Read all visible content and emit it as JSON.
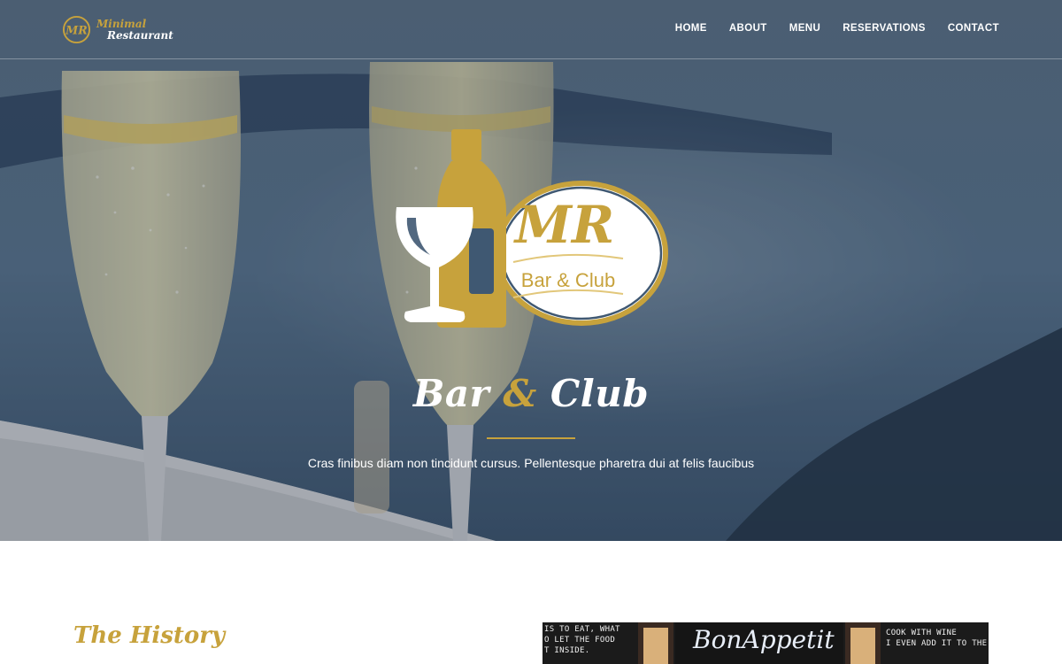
{
  "colors": {
    "gold": "#c7a23c",
    "navy": "#3f5872",
    "white": "#ffffff"
  },
  "brand": {
    "line1": "Minimal",
    "line2": "Restaurant",
    "mark_icon": "mr-monogram-icon"
  },
  "nav": {
    "items": [
      {
        "label": "HOME"
      },
      {
        "label": "ABOUT"
      },
      {
        "label": "MENU"
      },
      {
        "label": "RESERVATIONS"
      },
      {
        "label": "CONTACT"
      }
    ]
  },
  "hero": {
    "logo": {
      "monogram": "MR",
      "subtitle": "Bar & Club",
      "icons": [
        "wine-glass-icon",
        "wine-bottle-icon"
      ]
    },
    "title_part1": "Bar ",
    "title_amp": "&",
    "title_part2": " Club",
    "tagline": "Cras finibus diam non tincidunt cursus. Pellentesque pharetra dui at felis faucibus"
  },
  "history": {
    "title": "The History",
    "photo": {
      "board_left": "IS TO EAT, WHAT\nO LET THE FOOD\nT INSIDE.",
      "board_center": "BonAppetit",
      "board_right": "COOK WITH WINE\nI EVEN ADD IT TO THE"
    }
  }
}
